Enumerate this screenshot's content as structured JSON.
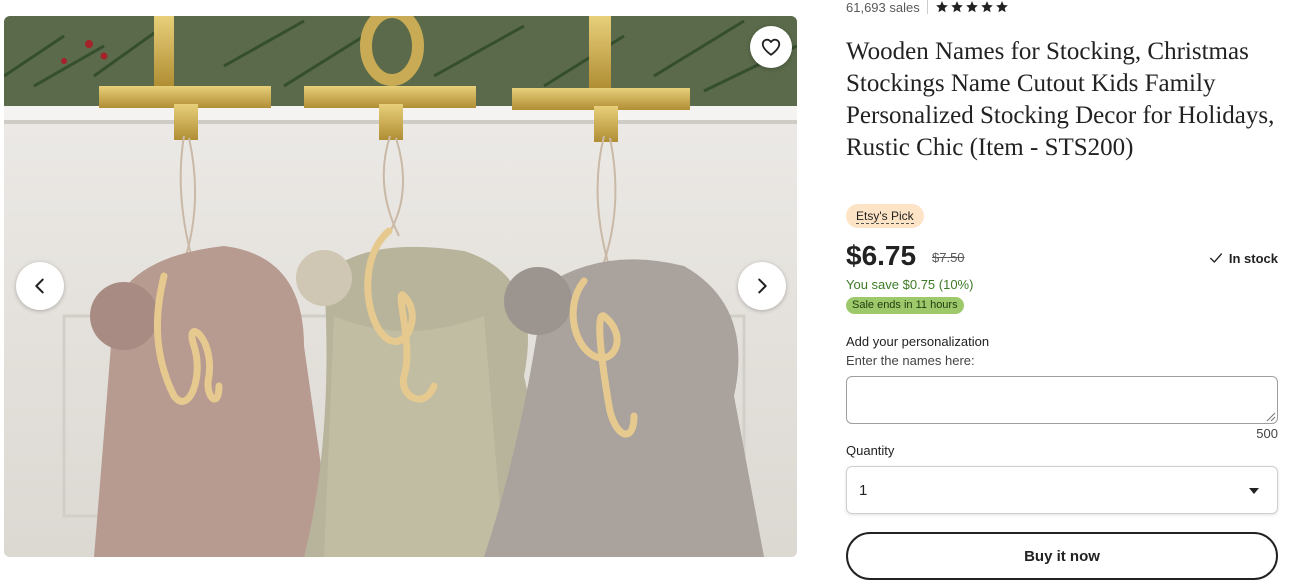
{
  "listing": {
    "sales": "61,693 sales",
    "rating_stars": 5,
    "title": "Wooden Names for Stocking, Christmas Stockings Name Cutout Kids Family Personalized Stocking Decor for Holidays, Rustic Chic (Item - STS200)",
    "badge": "Etsy's Pick",
    "price": "$6.75",
    "original_price": "$7.50",
    "stock": "In stock",
    "savings": "You save $0.75 (10%)",
    "sale_ends": "Sale ends in 11 hours"
  },
  "image": {
    "names_on_tags": [
      "John",
      "Asher",
      "Holly"
    ],
    "icons": {
      "favorite": "heart-icon",
      "prev": "chevron-left-icon",
      "next": "chevron-right-icon"
    }
  },
  "personalization": {
    "label": "Add your personalization",
    "instructions": "Enter the names here:",
    "value": "",
    "char_limit": "500"
  },
  "quantity": {
    "label": "Quantity",
    "selected": "1"
  },
  "actions": {
    "buy_label": "Buy it now"
  },
  "colors": {
    "badge_bg": "#fde4c6",
    "sale_badge_bg": "#9ec96a",
    "savings_text": "#3d7a26"
  }
}
